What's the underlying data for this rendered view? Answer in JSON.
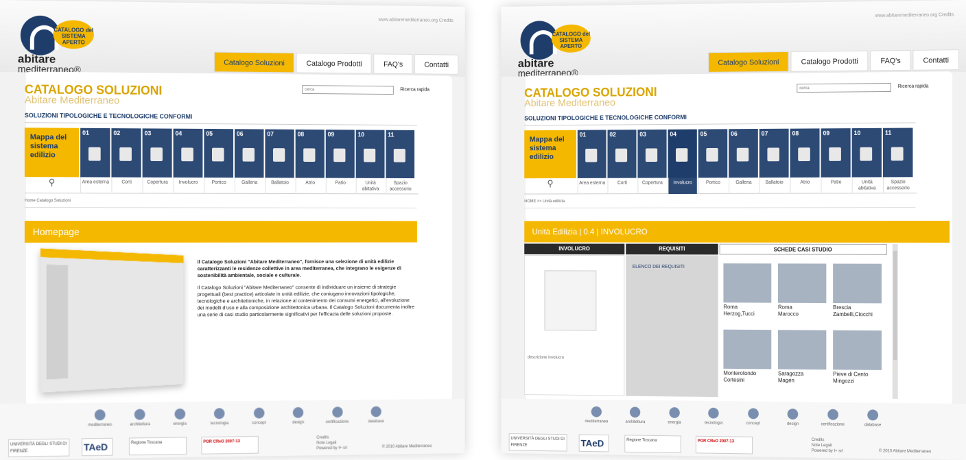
{
  "screen1": {
    "brand": {
      "badge": "CATALOGO del SISTEMA APERTO",
      "line1": "abitare",
      "line2": "mediterraneo®"
    },
    "top_links": "www.abitaremediterraneo.org Credits",
    "tabs": [
      "Catalogo Soluzioni",
      "Catalogo Prodotti",
      "FAQ's",
      "Contatti"
    ],
    "title": "CATALOGO SOLUZIONI",
    "subtitle": "Abitare Mediterraneo",
    "search": {
      "placeholder": "cerca",
      "label": "Ricerca rapida"
    },
    "section_title": "SOLUZIONI TIPOLOGICHE E TECNOLOGICHE CONFORMI",
    "mappa": "Mappa del sistema edilizio",
    "numbers": [
      "01",
      "02",
      "03",
      "04",
      "05",
      "06",
      "07",
      "08",
      "09",
      "10",
      "11"
    ],
    "labels": [
      "Area esterna",
      "Corti",
      "Copertura",
      "Involucro",
      "Portico",
      "Galleria",
      "Ballatoio",
      "Atrio",
      "Patio",
      "Unità abitativa",
      "Spazio accessorio"
    ],
    "breadcrumb": "Home Catalogo Soluzioni",
    "banner": "Homepage",
    "intro_bold": "Il Catalogo Soluzioni \"Abitare Mediterraneo\", fornisce una selezione di unità edilizie caratterizzanti le residenze collettive in area mediterranea, che integrano le esigenze di sostenibilità ambientale, sociale e culturale.",
    "intro_text": "Il Catalogo Soluzioni \"Abitare Mediterraneo\" consente di individuare un insieme di strategie progettuali (best practice) articolate in unità edilizie, che coniugano innovazioni tipologiche, tecnologiche e architettoniche, in relazione al contenimento dei consumi energetici, all'evoluzione dei modelli d'uso e alla composizione architettonica urbana. Il Catalogo Soluzioni documenta inoltre una serie di casi studio particolarmente significativi per l'efficacia delle soluzioni proposte."
  },
  "screen2": {
    "brand": {
      "badge": "CATALOGO del SISTEMA APERTO",
      "line1": "abitare",
      "line2": "mediterraneo®"
    },
    "top_links": "www.abitaremediterraneo.org Credits",
    "tabs": [
      "Catalogo Soluzioni",
      "Catalogo Prodotti",
      "FAQ's",
      "Contatti"
    ],
    "title": "CATALOGO SOLUZIONI",
    "subtitle": "Abitare Mediterraneo",
    "search": {
      "placeholder": "cerca",
      "label": "Ricerca rapida"
    },
    "section_title": "SOLUZIONI TIPOLOGICHE E TECNOLOGICHE CONFORMI",
    "mappa": "Mappa del sistema edilizio",
    "numbers": [
      "01",
      "02",
      "03",
      "04",
      "05",
      "06",
      "07",
      "08",
      "09",
      "10",
      "11"
    ],
    "labels": [
      "Area esterna",
      "Corti",
      "Copertura",
      "Involucro",
      "Portico",
      "Galleria",
      "Ballatoio",
      "Atrio",
      "Patio",
      "Unità abitativa",
      "Spazio accessorio"
    ],
    "breadcrumb": "HOME >> Unità edilizia",
    "banner": "Unità Edilizia | 0.4 | INVOLUCRO",
    "col_heads": [
      "INVOLUCRO",
      "REQUISITI",
      "SCHEDE CASI STUDIO"
    ],
    "requisiti": "ELENCO DEI REQUISITI",
    "description": "descrizione involucro",
    "cases": [
      {
        "city": "Roma",
        "name": "Herzog,Tucci"
      },
      {
        "city": "Roma",
        "name": "Marocco"
      },
      {
        "city": "Brescia",
        "name": "Zambelli,Ciocchi"
      },
      {
        "city": "Monterotondo",
        "name": "Cortesini"
      },
      {
        "city": "Saragozza",
        "name": "Magén"
      },
      {
        "city": "Pieve di Cento",
        "name": "Mingozzi"
      }
    ]
  },
  "footer": {
    "icons": [
      "mediterraneo",
      "architettura",
      "energia",
      "tecnologia",
      "concept",
      "design",
      "certificazione",
      "database"
    ],
    "logos": [
      "UNIVERSITÀ DEGLI STUDI DI FIRENZE",
      "TAeD",
      "Regione Toscana",
      "POR CReO 2007-13"
    ],
    "links": [
      "Credits",
      "Note Legali",
      "Powered by I+ srl"
    ],
    "copyright": "© 2010 Abitare Mediterraneo"
  },
  "colors": {
    "accent": "#f5b800",
    "navy": "#1f3d6b"
  }
}
